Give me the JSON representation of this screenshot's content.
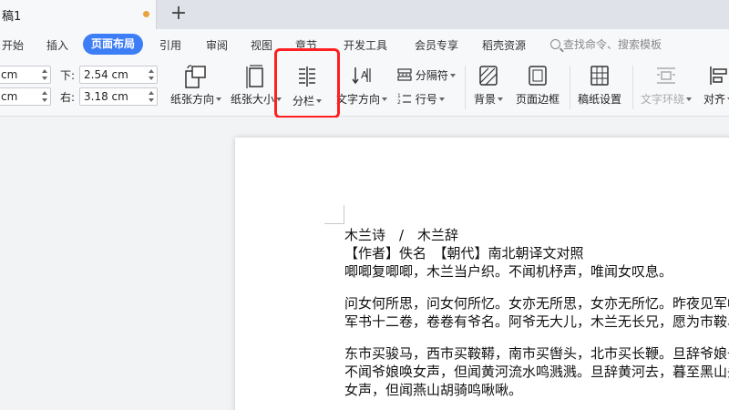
{
  "tab": {
    "title": "稿1"
  },
  "menu": {
    "items": [
      "开始",
      "插入",
      "页面布局",
      "引用",
      "审阅",
      "视图",
      "章节",
      "开发工具",
      "会员专享",
      "稻壳资源"
    ],
    "active_index": 2,
    "search_placeholder": "查找命令、搜索模板"
  },
  "ribbon": {
    "margins": {
      "top_value": "cm",
      "bottom_value": "cm",
      "down_label": "下:",
      "down_value": "2.54 cm",
      "right_label": "右:",
      "right_value": "3.18 cm"
    },
    "paper_orientation": "纸张方向",
    "paper_size": "纸张大小",
    "columns": "分栏",
    "text_direction": "文字方向",
    "separator": "分隔符",
    "line_number": "行号",
    "background": "背景",
    "page_border": "页面边框",
    "manuscript": "稿纸设置",
    "text_wrap": "文字环绕",
    "align": "对齐"
  },
  "highlight_color": "#ff1f1f",
  "accent_color": "#3d7ef6",
  "document": {
    "lines": [
      "木兰诗　/　木兰辞",
      "【作者】佚名　【朝代】南北朝译文对照",
      "唧唧复唧唧，木兰当户织。不闻机杼声，唯闻女叹息。",
      "",
      "问女何所思，问女何所忆。女亦无所思，女亦无所忆。昨夜见军帖",
      "军书十二卷，卷卷有爷名。阿爷无大儿，木兰无长兄，愿为市鞍马",
      "",
      "东市买骏马，西市买鞍鞯，南市买辔头，北市买长鞭。旦辞爷娘去",
      "不闻爷娘唤女声，但闻黄河流水鸣溅溅。旦辞黄河去，暮至黑山头",
      "女声，但闻燕山胡骑鸣啾啾。"
    ]
  }
}
